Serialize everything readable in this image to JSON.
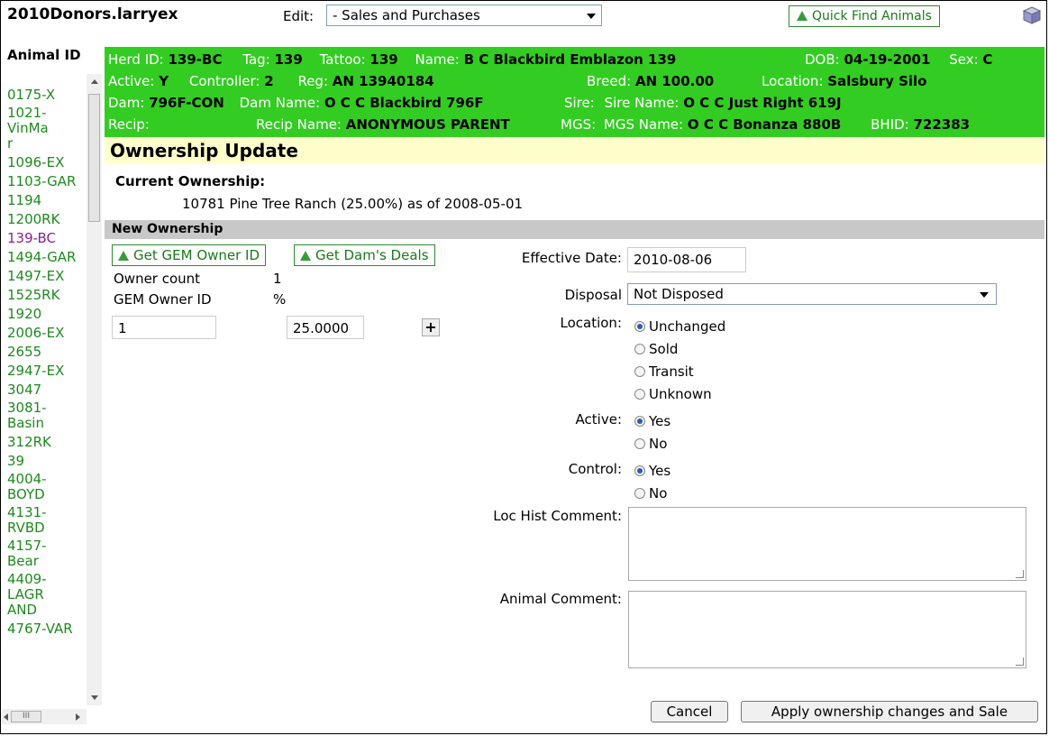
{
  "header": {
    "app_title": "2010Donors.larryex",
    "edit_label": "Edit:",
    "edit_value": "- Sales and Purchases",
    "quick_find_label": "Quick Find Animals"
  },
  "sidebar": {
    "heading": "Animal ID",
    "items": [
      {
        "label": "0175-X"
      },
      {
        "label": "1021-VinMar"
      },
      {
        "label": "1096-EX"
      },
      {
        "label": "1103-GAR"
      },
      {
        "label": "1194"
      },
      {
        "label": "1200RK"
      },
      {
        "label": "139-BC"
      },
      {
        "label": "1494-GAR"
      },
      {
        "label": "1497-EX"
      },
      {
        "label": "1525RK"
      },
      {
        "label": "1920"
      },
      {
        "label": "2006-EX"
      },
      {
        "label": "2655"
      },
      {
        "label": "2947-EX"
      },
      {
        "label": "3047"
      },
      {
        "label": "3081-Basin"
      },
      {
        "label": "312RK"
      },
      {
        "label": "39"
      },
      {
        "label": "4004-BOYD"
      },
      {
        "label": "4131-RVBD"
      },
      {
        "label": "4157-Bear"
      },
      {
        "label": "4409-LAGRAND"
      },
      {
        "label": "4767-VAR"
      }
    ],
    "hscroll_thumb": "III"
  },
  "info": {
    "herd_id_label": "Herd ID: ",
    "herd_id": "139-BC",
    "tag_label": "Tag: ",
    "tag": "139",
    "tattoo_label": "Tattoo: ",
    "tattoo": "139",
    "name_label": "Name: ",
    "name": "B C Blackbird Emblazon 139",
    "dob_label": "DOB: ",
    "dob": "04-19-2001",
    "sex_label": "Sex: ",
    "sex": "C",
    "active_label": "Active: ",
    "active": "Y",
    "controller_label": "Controller: ",
    "controller": "2",
    "reg_label": "Reg: ",
    "reg": "AN 13940184",
    "breed_label": "Breed: ",
    "breed": "AN 100.00",
    "location_label": "Location: ",
    "location": "Salsbury Silo",
    "dam_label": "Dam: ",
    "dam": "796F-CON",
    "dam_name_label": "Dam Name: ",
    "dam_name": "O C C Blackbird 796F",
    "sire_label": "Sire:",
    "sire_name_label": "Sire Name: ",
    "sire_name": "O C C Just Right 619J",
    "recip_label": "Recip:",
    "recip_name_label": "Recip Name: ",
    "recip_name": "ANONYMOUS PARENT",
    "mgs_label": "MGS:",
    "mgs_name_label": "MGS Name: ",
    "mgs_name": "O C C Bonanza 880B",
    "bhid_label": "BHID: ",
    "bhid": "722383"
  },
  "ownership": {
    "title": "Ownership Update",
    "current_heading": "Current Ownership:",
    "current_line": "10781 Pine Tree Ranch (25.00%) as of 2008-05-01",
    "new_heading": "New Ownership",
    "get_owner_btn": "Get GEM Owner ID",
    "get_deals_btn": "Get Dam's Deals",
    "owner_count_label": "Owner count",
    "owner_count": "1",
    "gem_owner_label": "GEM Owner ID",
    "pct_label": "%",
    "owner_id_value": "1",
    "pct_value": "25.0000",
    "plus": "+"
  },
  "form": {
    "effective_date_label": "Effective Date:",
    "effective_date": "2010-08-06",
    "disposal_label": "Disposal",
    "disposal_value": "Not Disposed",
    "location_label": "Location:",
    "location_options": [
      "Unchanged",
      "Sold",
      "Transit",
      "Unknown"
    ],
    "location_selected": "Unchanged",
    "active_label": "Active:",
    "active_options": [
      "Yes",
      "No"
    ],
    "control_label": "Control:",
    "control_options": [
      "Yes",
      "No"
    ],
    "loc_hist_label": "Loc Hist Comment:",
    "animal_comment_label": "Animal Comment:",
    "cancel_btn": "Cancel",
    "apply_btn": "Apply ownership changes and Sale"
  },
  "colors": {
    "green_panel": "#33cc22",
    "link_green": "#1e8a1e",
    "visited": "#8b2090",
    "banner": "#ffffcc"
  }
}
